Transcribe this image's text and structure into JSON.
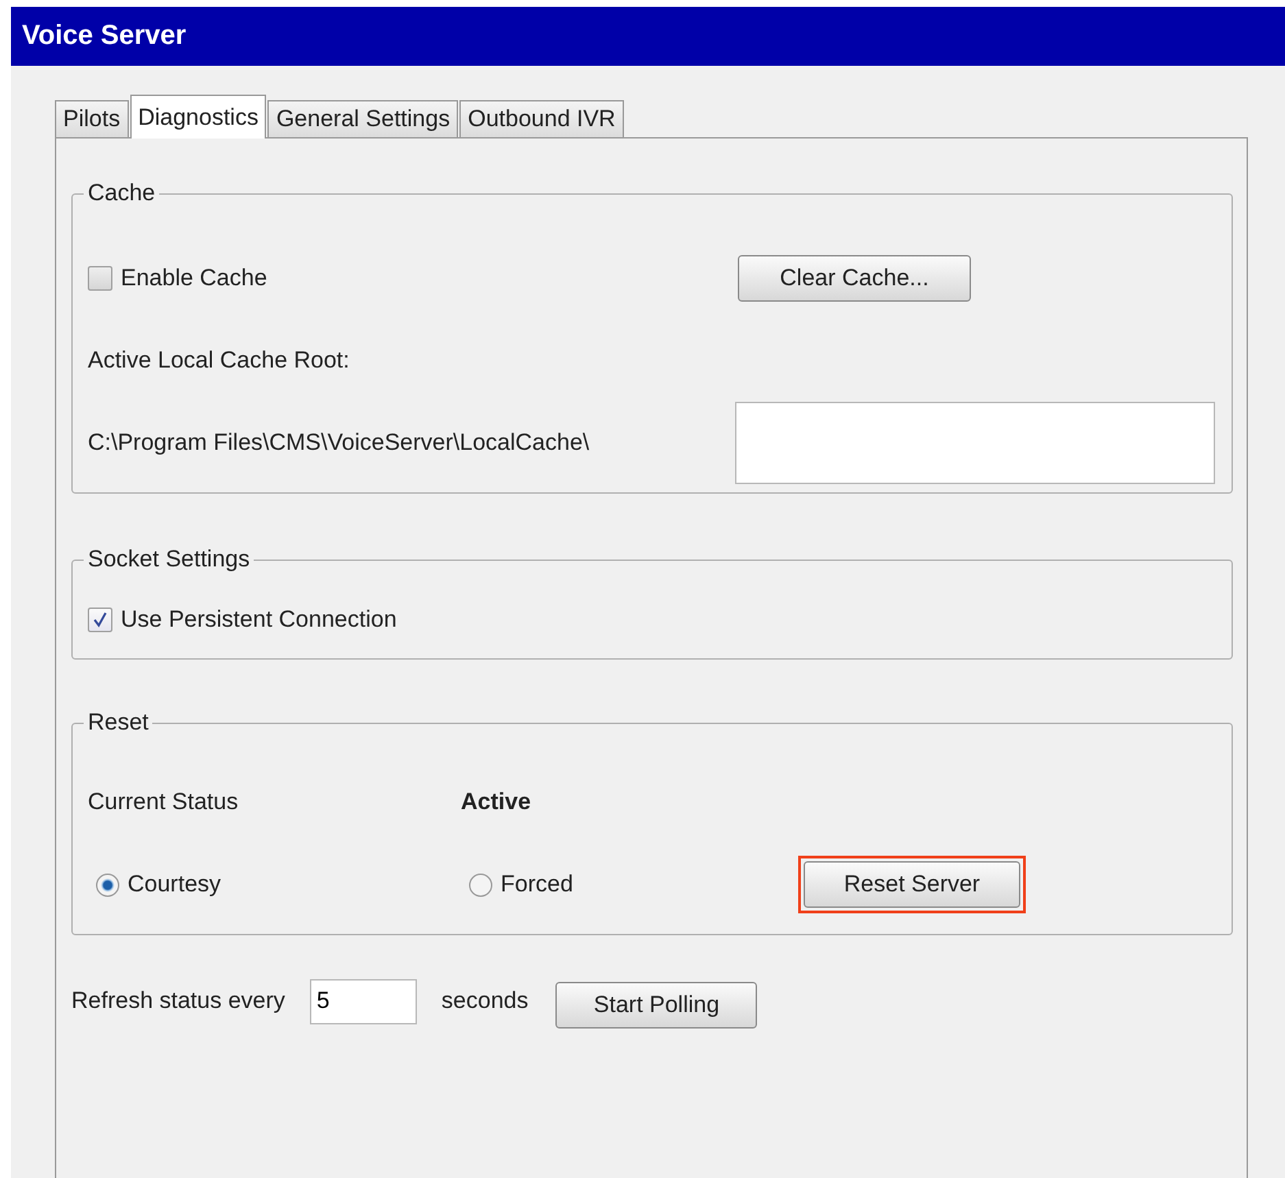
{
  "window": {
    "title": "Voice Server"
  },
  "tabs": [
    {
      "label": "Pilots",
      "selected": false
    },
    {
      "label": "Diagnostics",
      "selected": true
    },
    {
      "label": "General Settings",
      "selected": false
    },
    {
      "label": "Outbound IVR",
      "selected": false
    }
  ],
  "cache": {
    "title": "Cache",
    "enable_cache": {
      "label": "Enable Cache",
      "checked": false
    },
    "clear_button": "Clear Cache...",
    "root_label": "Active Local Cache Root:",
    "root_path": "C:\\Program Files\\CMS\\VoiceServer\\LocalCache\\"
  },
  "socket": {
    "title": "Socket Settings",
    "persistent": {
      "label": "Use Persistent Connection",
      "checked": true
    }
  },
  "reset": {
    "title": "Reset",
    "status_label": "Current Status",
    "status_value": "Active",
    "modes": [
      {
        "label": "Courtesy",
        "selected": true
      },
      {
        "label": "Forced",
        "selected": false
      }
    ],
    "reset_button": {
      "label": "Reset Server",
      "highlighted": true
    }
  },
  "refresh": {
    "label": "Refresh status every",
    "value": "5",
    "unit": "seconds",
    "button": "Start Polling"
  }
}
